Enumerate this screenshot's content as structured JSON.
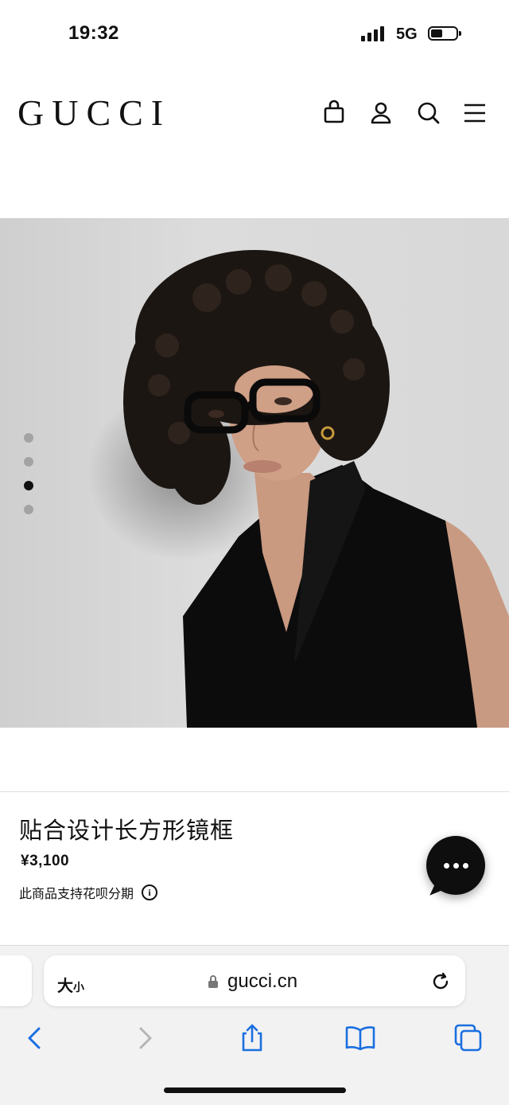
{
  "status_bar": {
    "time": "19:32",
    "network": "5G",
    "battery_level": 0.35
  },
  "header": {
    "logo": "GUCCI",
    "icons": [
      "shopping-bag-icon",
      "user-icon",
      "search-icon",
      "menu-icon"
    ]
  },
  "gallery": {
    "total_slides": 4,
    "active_slide": 3
  },
  "product": {
    "title": "贴合设计长方形镜框",
    "price": "¥3,100",
    "installment_text": "此商品支持花呗分期"
  },
  "safari": {
    "text_size_label_big": "大",
    "text_size_label_small": "小",
    "domain": "gucci.cn"
  },
  "colors": {
    "accent": "#111111",
    "bar_bg": "#f2f2f3",
    "link_blue": "#1a6fe0"
  }
}
